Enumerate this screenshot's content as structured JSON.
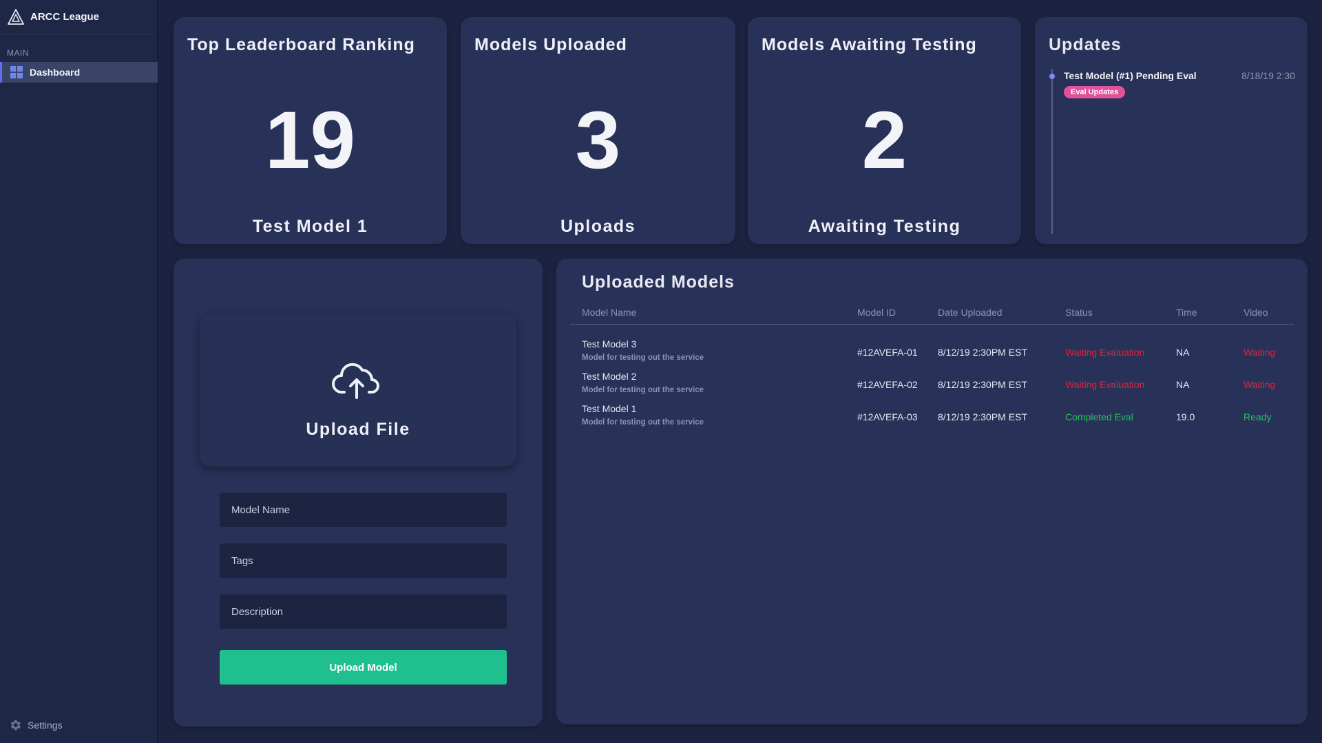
{
  "sidebar": {
    "brand": "ARCC League",
    "section": "MAIN",
    "items": [
      {
        "label": "Dashboard",
        "icon": "grid-icon"
      }
    ],
    "settings_label": "Settings"
  },
  "stats": [
    {
      "title": "Top Leaderboard Ranking",
      "value": "19",
      "caption": "Test Model 1"
    },
    {
      "title": "Models Uploaded",
      "value": "3",
      "caption": "Uploads"
    },
    {
      "title": "Models Awaiting Testing",
      "value": "2",
      "caption": "Awaiting Testing"
    }
  ],
  "updates": {
    "title": "Updates",
    "items": [
      {
        "text": "Test Model (#1) Pending Eval",
        "time": "8/18/19 2:30",
        "badge": "Eval Updates"
      }
    ]
  },
  "upload": {
    "dropzone_label": "Upload File",
    "fields": {
      "name": "Model Name",
      "tags": "Tags",
      "description": "Description"
    },
    "button": "Upload Model"
  },
  "table": {
    "title": "Uploaded Models",
    "headers": [
      "Model Name",
      "Model ID",
      "Date Uploaded",
      "Status",
      "Time",
      "Video"
    ],
    "rows": [
      {
        "name": "Test Model 3",
        "desc": "Model for testing out the service",
        "id": "#12AVEFA-01",
        "date": "8/12/19 2:30PM EST",
        "status": "Waiting Evaluation",
        "time": "NA",
        "video": "Waiting",
        "state": "waiting"
      },
      {
        "name": "Test Model 2",
        "desc": "Model for testing out the service",
        "id": "#12AVEFA-02",
        "date": "8/12/19 2:30PM EST",
        "status": "Waiting Evaluation",
        "time": "NA",
        "video": "Waiting",
        "state": "waiting"
      },
      {
        "name": "Test Model 1",
        "desc": "Model for testing out the service",
        "id": "#12AVEFA-03",
        "date": "8/12/19 2:30PM EST",
        "status": "Completed Eval",
        "time": "19.0",
        "video": "Ready",
        "state": "ready"
      }
    ]
  },
  "colors": {
    "background": "#1c2340",
    "card": "#283157",
    "accent": "#5b6ef5",
    "success": "#1fc08e",
    "status_waiting": "#e0243a",
    "status_ready": "#22c55e",
    "badge": "#e0529c"
  }
}
